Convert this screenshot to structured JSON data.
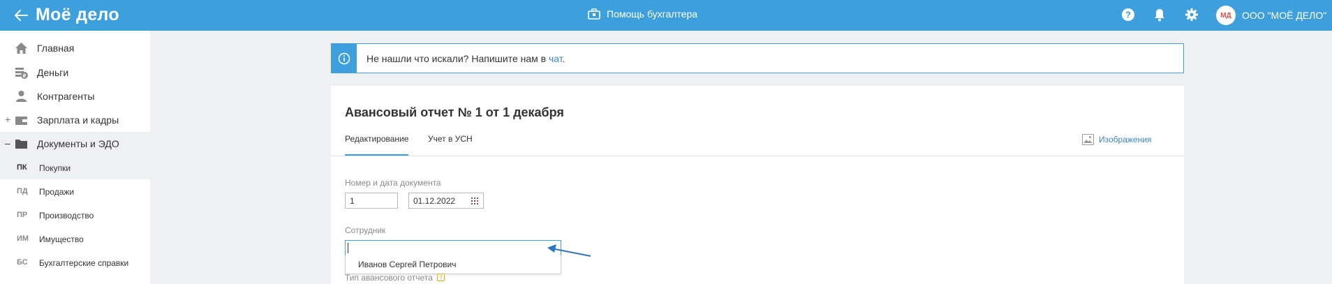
{
  "header": {
    "logo": "Моё дело",
    "helper_label": "Помощь бухгалтера",
    "org_avatar": "МД",
    "org_name": "ООО \"МОЁ ДЕЛО\""
  },
  "sidebar": {
    "items": [
      {
        "label": "Главная",
        "icon": "home-icon"
      },
      {
        "label": "Деньги",
        "icon": "money-icon"
      },
      {
        "label": "Контрагенты",
        "icon": "contractors-icon"
      },
      {
        "label": "Зарплата и кадры",
        "icon": "salary-icon",
        "toggle": "+"
      },
      {
        "label": "Документы и ЭДО",
        "icon": "folder-icon",
        "toggle": "–"
      }
    ],
    "sub_items": [
      {
        "abbr": "ПК",
        "label": "Покупки"
      },
      {
        "abbr": "ПД",
        "label": "Продажи"
      },
      {
        "abbr": "ПР",
        "label": "Производство"
      },
      {
        "abbr": "ИМ",
        "label": "Имущество"
      },
      {
        "abbr": "БС",
        "label": "Бухгалтерские справки"
      }
    ]
  },
  "banner": {
    "text": "Не нашли что искали? Напишите нам в ",
    "link": "чат",
    "suffix": "."
  },
  "document": {
    "title": "Авансовый отчет № 1 от 1 декабря",
    "tabs": [
      "Редактирование",
      "Учет в УСН"
    ],
    "images_link": "Изображения",
    "number_date_label": "Номер и дата документа",
    "number_value": "1",
    "date_value": "01.12.2022",
    "employee_label": "Сотрудник",
    "employee_value": "",
    "employee_option": "Иванов Сергей Петрович",
    "advance_type_label": "Тип авансового отчета"
  },
  "colors": {
    "brand": "#3d9fdc",
    "link": "#3d86c6",
    "annotation_arrow": "#2f74c0"
  }
}
